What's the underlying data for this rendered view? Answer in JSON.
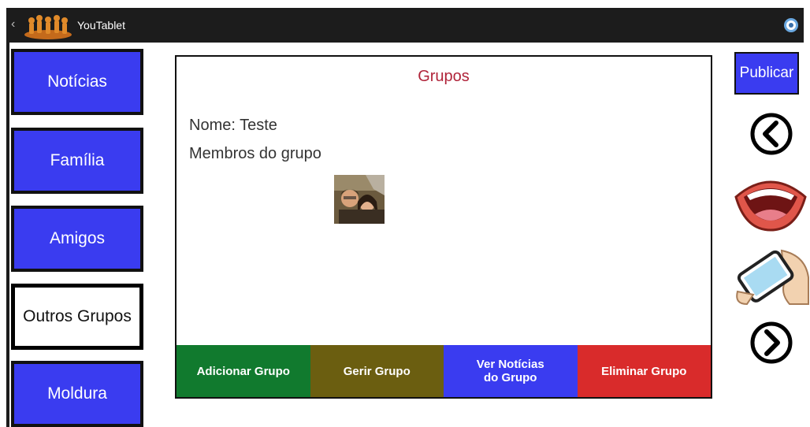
{
  "app": {
    "title": "YouTablet"
  },
  "nav": {
    "items": [
      {
        "label": "Notícias"
      },
      {
        "label": "Família"
      },
      {
        "label": "Amigos"
      },
      {
        "label": "Outros Grupos"
      },
      {
        "label": "Moldura"
      }
    ],
    "selected": "Outros Grupos"
  },
  "panel": {
    "title": "Grupos",
    "name_line": "Nome: Teste",
    "members_heading": "Membros do grupo"
  },
  "actions": [
    {
      "label": "Adicionar Grupo",
      "color": "#117a2e"
    },
    {
      "label": "Gerir Grupo",
      "color": "#6b5e10"
    },
    {
      "label": "Ver Notícias\ndo Grupo",
      "color": "#3a3cf0"
    },
    {
      "label": "Eliminar  Grupo",
      "color": "#d92b2b"
    }
  ],
  "side": {
    "publish_label": "Publicar",
    "icons": [
      "back-icon",
      "speak-mouth-icon",
      "tablet-tilt-icon",
      "forward-icon"
    ]
  },
  "colors": {
    "accent_blue": "#3a3cf0",
    "title_red": "#b0243a",
    "topbar": "#1c1c1c"
  }
}
